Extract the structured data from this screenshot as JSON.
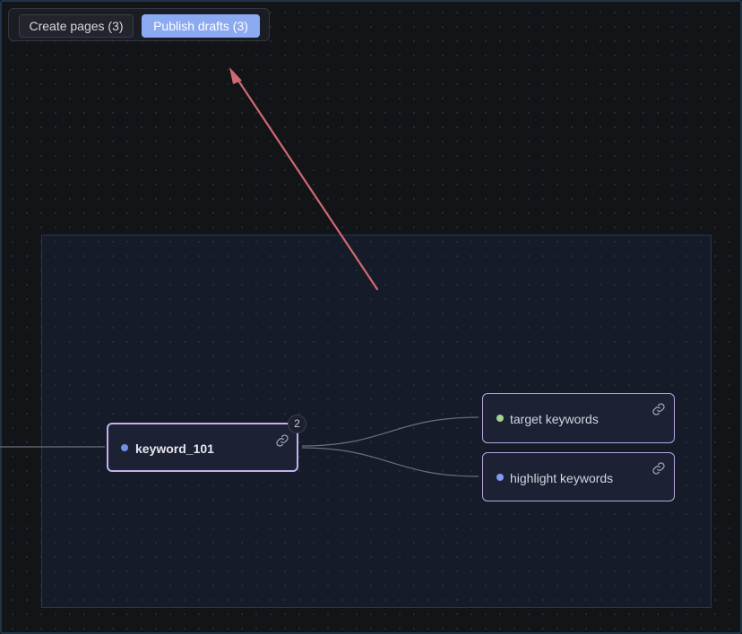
{
  "toolbar": {
    "create_label": "Create pages (3)",
    "publish_label": "Publish drafts (3)"
  },
  "nodes": {
    "main": {
      "label": "keyword_101",
      "badge": "2",
      "icon": "link-icon",
      "dot_color": "#6f92e6"
    },
    "target": {
      "label": "target keywords",
      "icon": "link-icon",
      "dot_color": "#9fd48d"
    },
    "highlight": {
      "label": "highlight keywords",
      "icon": "link-icon",
      "dot_color": "#7f9cf0"
    }
  },
  "colors": {
    "background": "#131418",
    "accent": "#8caaf2",
    "node_border": "#c3b1ee",
    "arrow": "#d06a72",
    "edge": "#6b6f7e"
  }
}
